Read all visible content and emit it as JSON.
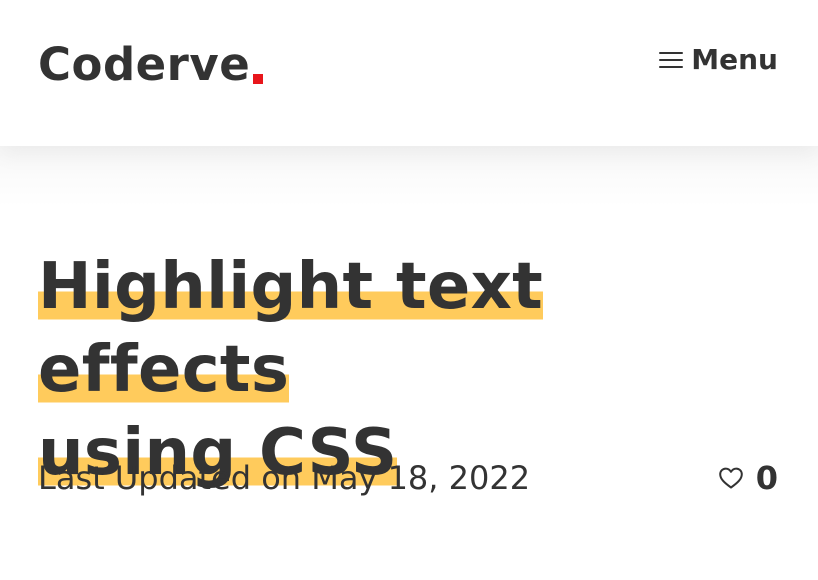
{
  "header": {
    "logo_text": "Coderve",
    "menu_label": "Menu",
    "accent_color": "#e8161b"
  },
  "article": {
    "title_line1": "Highlight text effects",
    "title_line2": "using CSS",
    "highlight_color": "#ffcb5c",
    "updated_text": "Last Updated on May 18, 2022",
    "like_count": "0",
    "like_icon": "heart-icon"
  }
}
